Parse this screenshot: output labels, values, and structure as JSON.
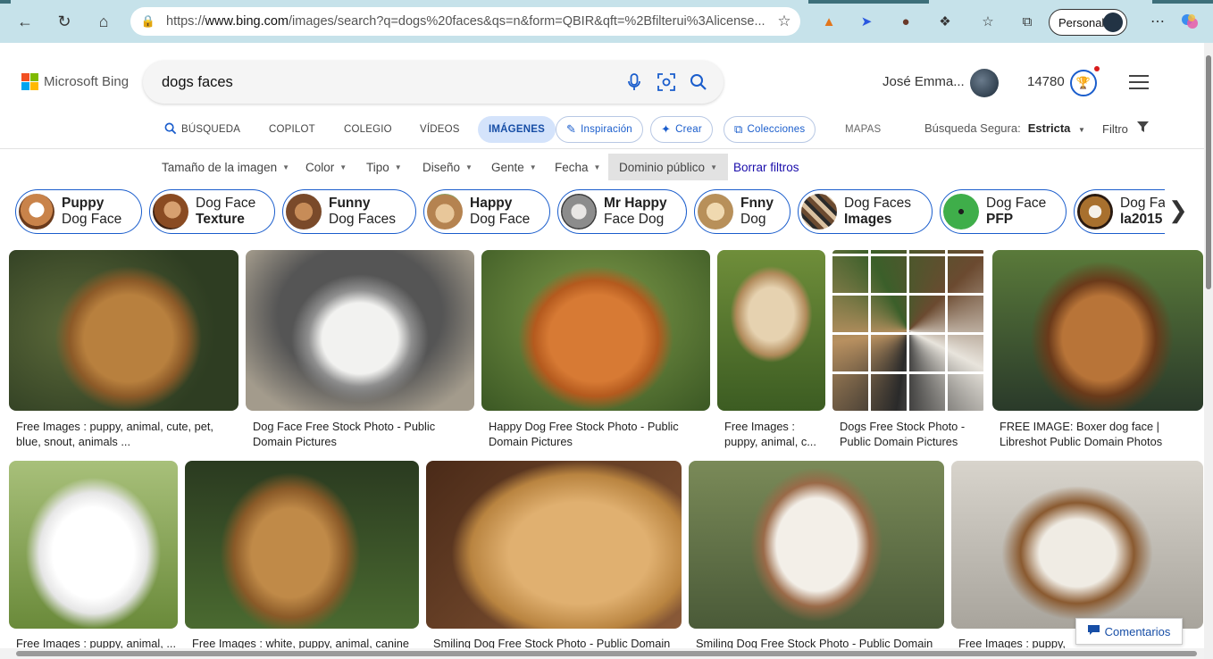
{
  "browser": {
    "url_prefix": "https://",
    "url_domain": "www.bing.com",
    "url_rest": "/images/search?q=dogs%20faces&qs=n&form=QBIR&qft=%2Bfilterui%3Alicense...",
    "profile_label": "Personal"
  },
  "header": {
    "logo_text": "Microsoft Bing",
    "search_query": "dogs faces",
    "user_name": "José Emma...",
    "points": "14780"
  },
  "tabs": [
    {
      "label": "BÚSQUEDA"
    },
    {
      "label": "COPILOT"
    },
    {
      "label": "COLEGIO"
    },
    {
      "label": "VÍDEOS"
    },
    {
      "label": "IMÁGENES"
    },
    {
      "label": "Inspiración"
    },
    {
      "label": "Crear"
    },
    {
      "label": "Colecciones"
    },
    {
      "label": "MAPAS"
    }
  ],
  "safe_search": {
    "label": "Búsqueda Segura:",
    "value": "Estricta"
  },
  "filter_label": "Filtro",
  "filters": [
    {
      "label": "Tamaño de la imagen"
    },
    {
      "label": "Color"
    },
    {
      "label": "Tipo"
    },
    {
      "label": "Diseño"
    },
    {
      "label": "Gente"
    },
    {
      "label": "Fecha"
    },
    {
      "label": "Dominio público"
    },
    {
      "label": "Borrar filtros"
    }
  ],
  "chips": [
    {
      "bold": "Puppy",
      "normal": "Dog Face"
    },
    {
      "normal": "Dog Face",
      "bold": "Texture"
    },
    {
      "bold": "Funny",
      "normal": "Dog Faces"
    },
    {
      "bold": "Happy",
      "normal": "Dog Face"
    },
    {
      "bold": "Mr Happy",
      "normal": "Face Dog"
    },
    {
      "bold": "Fnny",
      "normal": "Dog"
    },
    {
      "normal": "Dog Faces",
      "bold": "Images"
    },
    {
      "normal": "Dog Face",
      "bold": "PFP"
    },
    {
      "normal": "Dog Fa",
      "bold": "la2015"
    }
  ],
  "results_row1": [
    {
      "caption": "Free Images : puppy, animal, cute, pet, blue, snout, animals ..."
    },
    {
      "caption": "Dog Face Free Stock Photo - Public Domain Pictures"
    },
    {
      "caption": "Happy Dog Free Stock Photo - Public Domain Pictures"
    },
    {
      "caption": "Free Images : puppy, animal, c..."
    },
    {
      "caption": "Dogs Free Stock Photo - Public Domain Pictures"
    },
    {
      "caption": "FREE IMAGE: Boxer dog face | Libreshot Public Domain Photos"
    }
  ],
  "results_row2": [
    {
      "caption": "Free Images : puppy, animal, ..."
    },
    {
      "caption": "Free Images : white, puppy, animal, canine ..."
    },
    {
      "caption": "Smiling Dog Free Stock Photo - Public Domain ..."
    },
    {
      "caption": "Smiling Dog Free Stock Photo - Public Domain ..."
    },
    {
      "caption": "Free Images : puppy, c..."
    }
  ],
  "feedback_label": "Comentarios"
}
